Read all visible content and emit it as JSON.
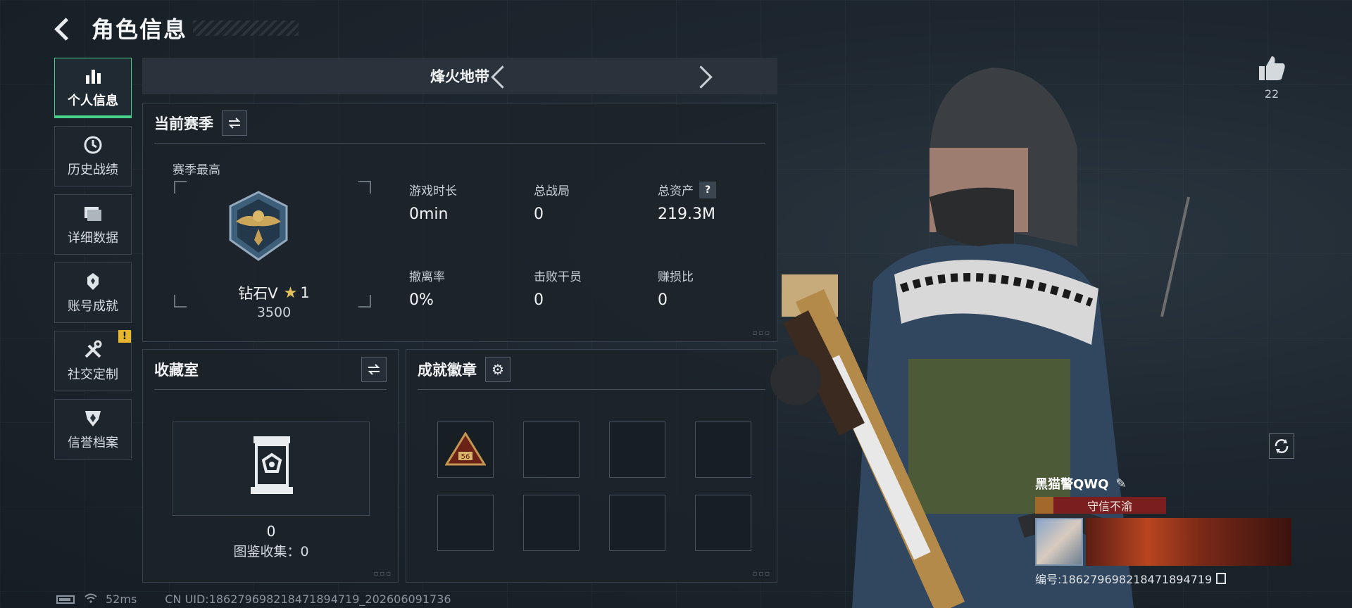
{
  "header": {
    "title": "角色信息"
  },
  "nav": {
    "items": [
      {
        "label": "个人信息",
        "icon": "bar-chart-icon",
        "active": true
      },
      {
        "label": "历史战绩",
        "icon": "clock-icon",
        "active": false
      },
      {
        "label": "详细数据",
        "icon": "folder-icon",
        "active": false
      },
      {
        "label": "账号成就",
        "icon": "medal-icon",
        "active": false
      },
      {
        "label": "社交定制",
        "icon": "tools-icon",
        "active": false,
        "badge": "!"
      },
      {
        "label": "信誉档案",
        "icon": "shield-icon",
        "active": false
      }
    ]
  },
  "mode": {
    "title": "烽火地带"
  },
  "season": {
    "title": "当前赛季",
    "best_label": "赛季最高",
    "rank_name": "钻石V",
    "rank_stars": "1",
    "rank_score": "3500",
    "stats": [
      {
        "label": "游戏时长",
        "value": "0min"
      },
      {
        "label": "总战局",
        "value": "0"
      },
      {
        "label": "总资产",
        "value": "219.3M",
        "help": "?"
      },
      {
        "label": "撤离率",
        "value": "0%"
      },
      {
        "label": "击败干员",
        "value": "0"
      },
      {
        "label": "赚损比",
        "value": "0"
      }
    ]
  },
  "collection": {
    "title": "收藏室",
    "count": "0",
    "caption": "图鉴收集：0"
  },
  "achievements": {
    "title": "成就徽章",
    "badge_text": "56"
  },
  "like": {
    "count": "22"
  },
  "player": {
    "name": "黑猫警QWQ",
    "title": "守信不渝",
    "uid_label": "编号:186279698218471894719"
  },
  "status": {
    "ping": "52ms",
    "uid": "CN UID:186279698218471894719_202606091736"
  },
  "colors": {
    "accent": "#47d28a",
    "warning": "#e5b62e",
    "title_plate": "#7a1e1f"
  }
}
